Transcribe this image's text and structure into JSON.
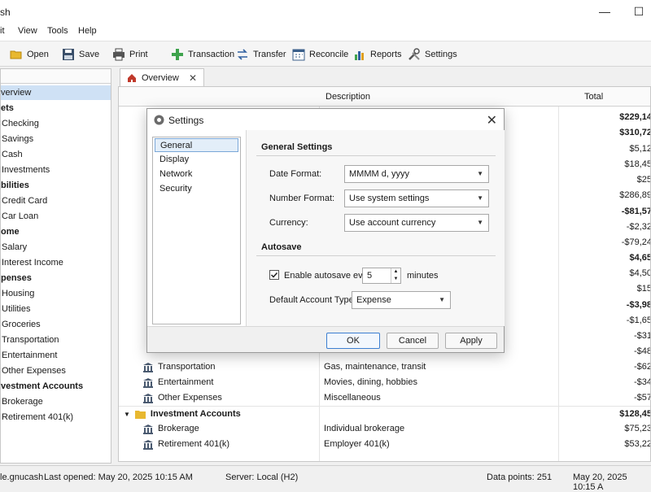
{
  "window": {
    "title": "sh",
    "minimize": "—",
    "maximize": "☐"
  },
  "menu": [
    "it",
    "View",
    "Tools",
    "Help"
  ],
  "toolbar": {
    "open": "Open",
    "save": "Save",
    "print": "Print",
    "transaction": "Transaction",
    "transfer": "Transfer",
    "reconcile": "Reconcile",
    "reports": "Reports",
    "settings": "Settings"
  },
  "tree": [
    {
      "label": "verview",
      "kind": "item",
      "selected": true
    },
    {
      "label": "ets",
      "kind": "group"
    },
    {
      "label": "Checking",
      "kind": "item"
    },
    {
      "label": "Savings",
      "kind": "item"
    },
    {
      "label": "Cash",
      "kind": "item"
    },
    {
      "label": "Investments",
      "kind": "item"
    },
    {
      "label": "bilities",
      "kind": "group"
    },
    {
      "label": "Credit Card",
      "kind": "item"
    },
    {
      "label": "Car Loan",
      "kind": "item"
    },
    {
      "label": "ome",
      "kind": "group"
    },
    {
      "label": "Salary",
      "kind": "item"
    },
    {
      "label": "Interest Income",
      "kind": "item"
    },
    {
      "label": "penses",
      "kind": "group"
    },
    {
      "label": "Housing",
      "kind": "item"
    },
    {
      "label": "Utilities",
      "kind": "item"
    },
    {
      "label": "Groceries",
      "kind": "item"
    },
    {
      "label": "Transportation",
      "kind": "item"
    },
    {
      "label": "Entertainment",
      "kind": "item"
    },
    {
      "label": "Other Expenses",
      "kind": "item"
    },
    {
      "label": "vestment Accounts",
      "kind": "group"
    },
    {
      "label": "Brokerage",
      "kind": "item"
    },
    {
      "label": "Retirement 401(k)",
      "kind": "item"
    }
  ],
  "tab": {
    "label": "Overview",
    "close": "✕"
  },
  "grid": {
    "headers": {
      "description": "Description",
      "total": "Total"
    },
    "totals_visible": [
      "$229,14",
      "$310,72",
      "$5,12",
      "$18,45",
      "$25",
      "$286,89",
      "-$81,57",
      "-$2,32",
      "-$79,24",
      "$4,65",
      "$4,50",
      "$15",
      "-$3,98",
      "-$1,65",
      "-$31",
      "-$48"
    ],
    "rows": [
      {
        "name": "Transportation",
        "description": "Gas, maintenance, transit",
        "total": "-$62",
        "kind": "item"
      },
      {
        "name": "Entertainment",
        "description": "Movies, dining, hobbies",
        "total": "-$34",
        "kind": "item"
      },
      {
        "name": "Other Expenses",
        "description": "Miscellaneous",
        "total": "-$57",
        "kind": "item"
      },
      {
        "name": "Investment Accounts",
        "description": "",
        "total": "$128,45",
        "kind": "group"
      },
      {
        "name": "Brokerage",
        "description": "Individual brokerage",
        "total": "$75,23",
        "kind": "item"
      },
      {
        "name": "Retirement 401(k)",
        "description": "Employer 401(k)",
        "total": "$53,22",
        "kind": "item"
      }
    ]
  },
  "status": {
    "file": "le.gnucash",
    "last_opened": "Last opened: May 20, 2025 10:15 AM",
    "server": "Server:  Local  (H2)",
    "data_points": "Data points: 251",
    "date": "May 20, 2025 10:15 A"
  },
  "dialog": {
    "title": "Settings",
    "close": "✕",
    "categories": [
      "General",
      "Display",
      "Network",
      "Security"
    ],
    "selected_category": "General",
    "general": {
      "section_title": "General Settings",
      "date_format_label": "Date Format:",
      "date_format_value": "MMMM d, yyyy",
      "number_format_label": "Number Format:",
      "number_format_value": "Use system settings",
      "currency_label": "Currency:",
      "currency_value": "Use account currency"
    },
    "autosave": {
      "section_title": "Autosave",
      "enable_label": "Enable autosave every",
      "enabled": true,
      "minutes_value": "5",
      "minutes_label": "minutes",
      "default_type_label": "Default Account Type:",
      "default_type_value": "Expense"
    },
    "buttons": {
      "ok": "OK",
      "cancel": "Cancel",
      "apply": "Apply"
    }
  }
}
